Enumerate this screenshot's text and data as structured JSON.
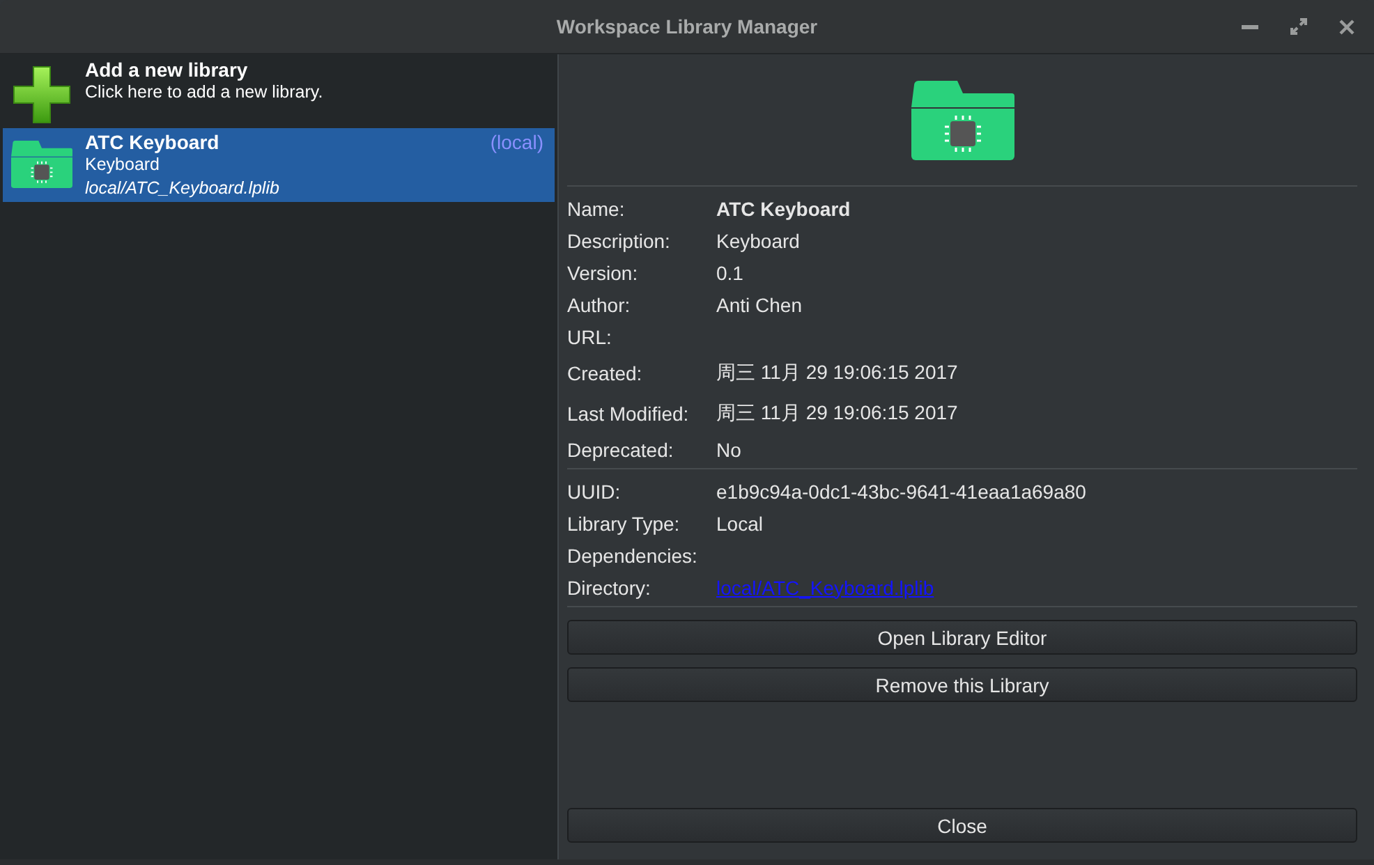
{
  "window": {
    "title": "Workspace Library Manager"
  },
  "libraries": [
    {
      "kind": "add",
      "title": "Add a new library",
      "subtitle": "Click here to add a new library.",
      "selected": false
    },
    {
      "kind": "library",
      "title": "ATC Keyboard",
      "tag": "(local)",
      "description": "Keyboard",
      "path": "local/ATC_Keyboard.lplib",
      "selected": true
    }
  ],
  "details": {
    "sections": [
      {
        "fields": [
          {
            "label": "Name:",
            "value": "ATC Keyboard",
            "kind": "bold"
          },
          {
            "label": "Description:",
            "value": "Keyboard",
            "kind": "text"
          },
          {
            "label": "Version:",
            "value": "0.1",
            "kind": "text"
          },
          {
            "label": "Author:",
            "value": "Anti Chen",
            "kind": "text"
          },
          {
            "label": "URL:"
          },
          {
            "label": "Created:",
            "value": "周三 11月 29 19:06:15 2017",
            "kind": "text"
          },
          {
            "label": "Last Modified:",
            "value": "周三 11月 29 19:06:15 2017",
            "kind": "text"
          },
          {
            "label": "Deprecated:",
            "value": "No",
            "kind": "text"
          }
        ]
      },
      {
        "fields": [
          {
            "label": "UUID:",
            "value": "e1b9c94a-0dc1-43bc-9641-41eaa1a69a80",
            "kind": "text"
          },
          {
            "label": "Library Type:",
            "value": "Local",
            "kind": "text"
          },
          {
            "label": "Dependencies:"
          },
          {
            "label": "Directory:",
            "value": "local/ATC_Keyboard.lplib",
            "kind": "link"
          }
        ]
      }
    ],
    "buttons": [
      "Open Library Editor",
      "Remove this Library"
    ]
  },
  "close_button": "Close"
}
